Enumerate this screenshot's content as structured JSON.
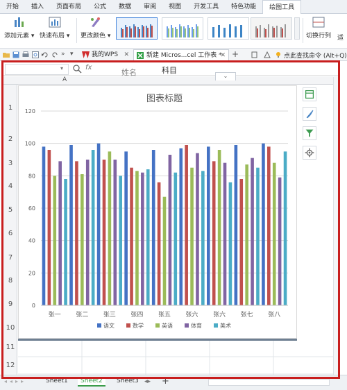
{
  "ribbon_tabs": [
    "开始",
    "插入",
    "页面布局",
    "公式",
    "数据",
    "审阅",
    "视图",
    "开发工具",
    "特色功能",
    "绘图工具"
  ],
  "ribbon": {
    "add_element": "添加元素",
    "quick_layout": "快速布局",
    "change_color": "更改颜色",
    "switch_row_col": "切换行列",
    "partial": "适"
  },
  "tabbar": {
    "tab1": "我的WPS",
    "tab2": "新建 Micros...cel 工作表 *",
    "plus": "+",
    "search": "点此查找命令 (Alt+Q)"
  },
  "formula_bar": {
    "namebox": "",
    "fx": "fx",
    "content": "科目",
    "cell_under": "姓名"
  },
  "grid": {
    "col_a": "A",
    "rows": [
      "1",
      "2",
      "3",
      "4",
      "5",
      "6",
      "7",
      "8",
      "9",
      "10",
      "11",
      "12"
    ]
  },
  "chart_data": {
    "type": "bar",
    "title": "图表标题",
    "categories": [
      "张一",
      "张二",
      "张三",
      "张四",
      "张五",
      "张六",
      "张六",
      "张七",
      "张八"
    ],
    "ylim": [
      0,
      120
    ],
    "yticks": [
      0,
      20,
      40,
      60,
      80,
      100,
      120
    ],
    "grid": true,
    "legend_position": "bottom",
    "series": [
      {
        "name": "语文",
        "color": "#4472c4",
        "values": [
          98,
          99,
          100,
          95,
          96,
          97,
          98,
          99,
          100
        ]
      },
      {
        "name": "数学",
        "color": "#c0504d",
        "values": [
          96,
          89,
          90,
          85,
          76,
          99,
          89,
          78,
          98
        ]
      },
      {
        "name": "英语",
        "color": "#9bbb59",
        "values": [
          80,
          81,
          95,
          83,
          67,
          85,
          96,
          87,
          88
        ]
      },
      {
        "name": "体育",
        "color": "#8064a2",
        "values": [
          89,
          90,
          90,
          82,
          93,
          94,
          88,
          91,
          79
        ]
      },
      {
        "name": "美术",
        "color": "#4bacc6",
        "values": [
          78,
          96,
          80,
          84,
          82,
          83,
          76,
          85,
          95
        ]
      }
    ]
  },
  "sheets": [
    "Sheet1",
    "Sheet2",
    "Sheet3"
  ],
  "sheet_active": 1,
  "sheet_add": "+"
}
